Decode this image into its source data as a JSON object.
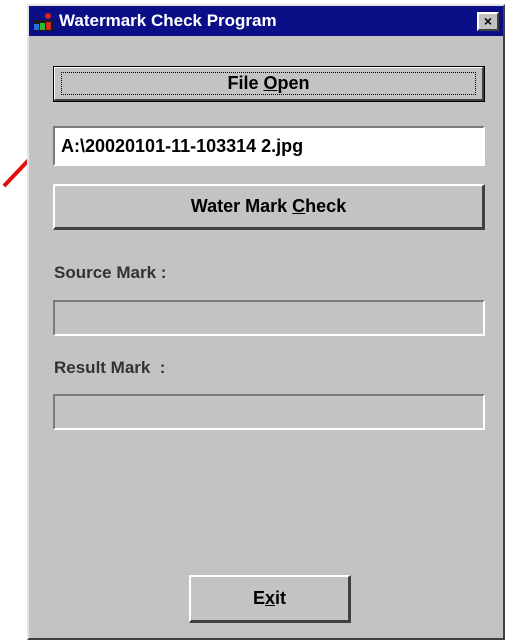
{
  "window": {
    "title": "Watermark Check Program",
    "close_glyph": "×",
    "titlebar_color": "#0a0f87",
    "face_color": "#c3c3c3"
  },
  "buttons": {
    "file_open": {
      "text_before": "File ",
      "mnemonic": "O",
      "text_after": "pen"
    },
    "water_mark_check": {
      "text_before": "Water Mark ",
      "mnemonic": "C",
      "text_after": "heck"
    },
    "exit": {
      "text_before": "E",
      "mnemonic": "x",
      "text_after": "it"
    }
  },
  "file_path": {
    "value": "A:\\20020101-11-103314 2.jpg"
  },
  "source_mark": {
    "label": "Source Mark :",
    "value": ""
  },
  "result_mark": {
    "label": "Result Mark  :",
    "value": ""
  },
  "annotation": {
    "icon": "red-arrow-icon",
    "color": "#e01010"
  }
}
